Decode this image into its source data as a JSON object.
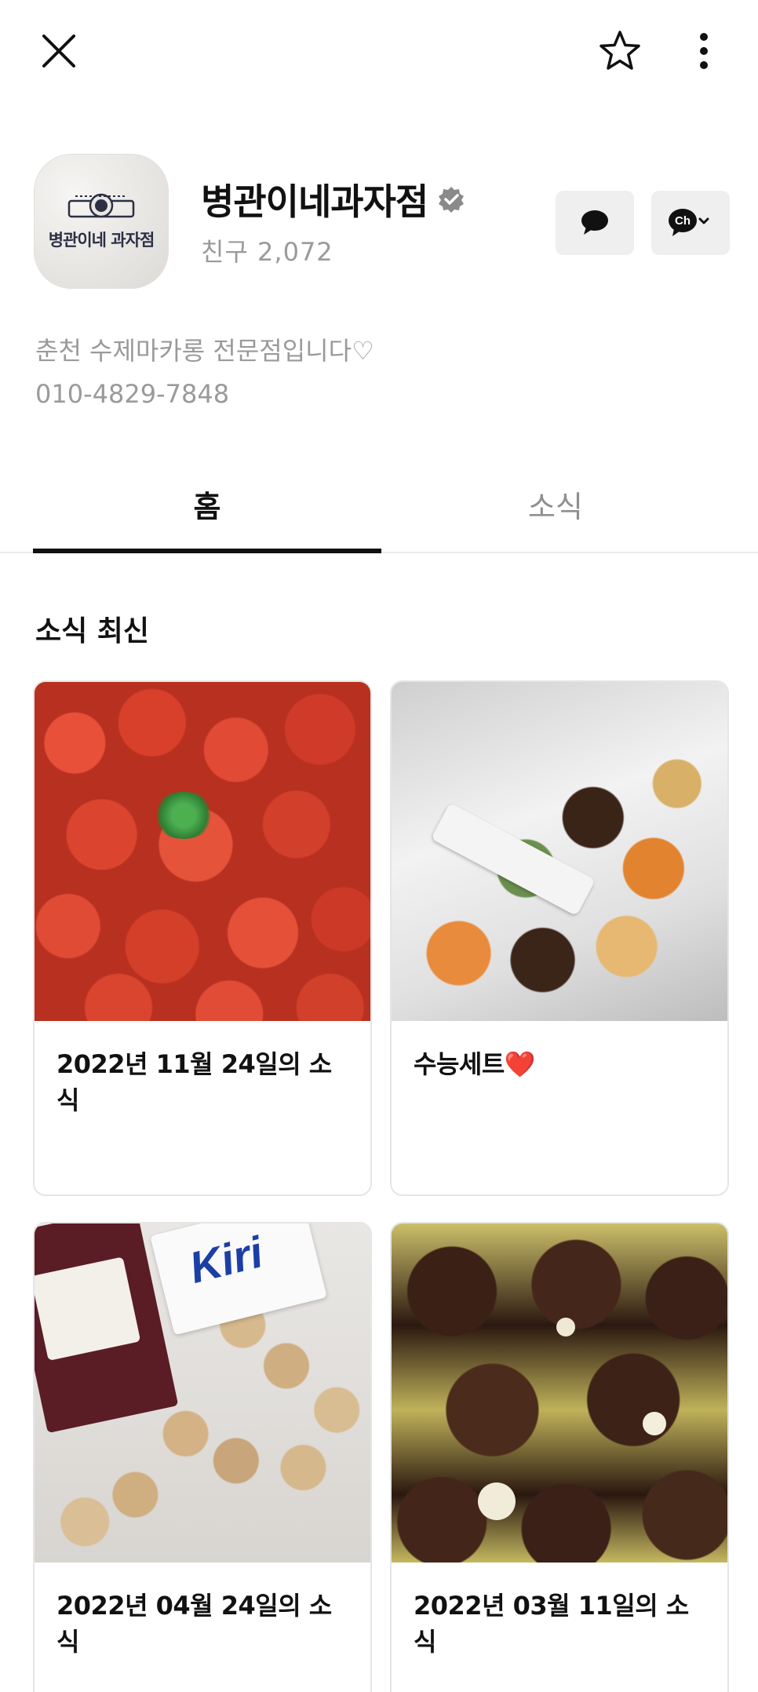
{
  "header": {
    "close_icon": "close-icon",
    "favorite_icon": "star-outline-icon",
    "more_icon": "more-vertical-icon"
  },
  "profile": {
    "avatar_text": "병관이네 과자점",
    "name": "병관이네과자점",
    "friends": "친구 2,072",
    "chat_icon": "chat-bubble-icon",
    "channel_icon": "ch-dropdown-icon",
    "channel_label": "Ch",
    "description_line1": "춘천 수제마카롱 전문점입니다♡",
    "description_line2": "010-4829-7848"
  },
  "tabs": [
    {
      "label": "홈",
      "active": true
    },
    {
      "label": "소식",
      "active": false
    }
  ],
  "section": {
    "title": "소식 최신"
  },
  "posts": [
    {
      "caption": "2022년 11월 24일의 소식"
    },
    {
      "caption": "수능세트❤️"
    },
    {
      "caption": "2022년 04월 24일의 소식"
    },
    {
      "caption": "2022년 03월 11일의 소식"
    }
  ],
  "colors": {
    "text_primary": "#111111",
    "text_secondary": "#9a9a9a",
    "button_bg": "#efefef",
    "tab_indicator": "#111111",
    "verified_badge": "#8a8a8a"
  }
}
